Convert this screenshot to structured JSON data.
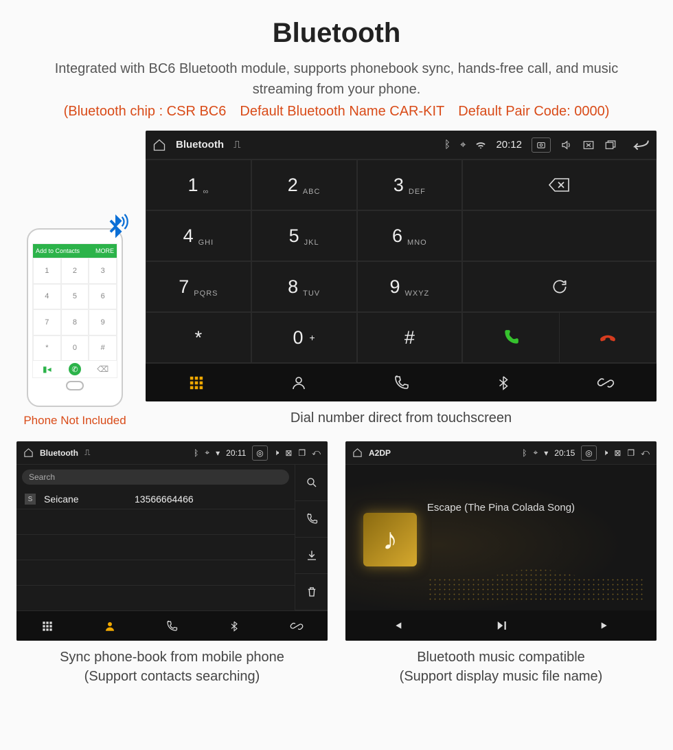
{
  "page": {
    "title": "Bluetooth",
    "subtitle": "Integrated with BC6 Bluetooth module, supports phonebook sync, hands-free call, and music streaming from your phone.",
    "red_note": "(Bluetooth chip : CSR BC6 Default Bluetooth Name CAR-KIT Default Pair Code: 0000)"
  },
  "phone_mock": {
    "bar_label": "Add to Contacts",
    "bar_right": "MORE",
    "keys": [
      "1",
      "2",
      "3",
      "4",
      "5",
      "6",
      "7",
      "8",
      "9",
      "*",
      "0",
      "#"
    ],
    "caption": "Phone Not Included"
  },
  "dialer": {
    "status": {
      "title": "Bluetooth",
      "time": "20:12"
    },
    "keys": [
      {
        "d": "1",
        "s": "∞"
      },
      {
        "d": "2",
        "s": "ABC"
      },
      {
        "d": "3",
        "s": "DEF"
      },
      {
        "d": "4",
        "s": "GHI"
      },
      {
        "d": "5",
        "s": "JKL"
      },
      {
        "d": "6",
        "s": "MNO"
      },
      {
        "d": "7",
        "s": "PQRS"
      },
      {
        "d": "8",
        "s": "TUV"
      },
      {
        "d": "9",
        "s": "WXYZ"
      },
      {
        "d": "*",
        "s": ""
      },
      {
        "d": "0",
        "s": "+",
        "sup": true
      },
      {
        "d": "#",
        "s": ""
      }
    ],
    "caption": "Dial number direct from touchscreen"
  },
  "contacts": {
    "status": {
      "title": "Bluetooth",
      "time": "20:11"
    },
    "search_placeholder": "Search",
    "row": {
      "letter": "S",
      "name": "Seicane",
      "number": "13566664466"
    },
    "caption_line1": "Sync phone-book from mobile phone",
    "caption_line2": "(Support contacts searching)"
  },
  "music": {
    "status": {
      "title": "A2DP",
      "time": "20:15"
    },
    "song": "Escape (The Pina Colada Song)",
    "caption_line1": "Bluetooth music compatible",
    "caption_line2": "(Support display music file name)"
  }
}
